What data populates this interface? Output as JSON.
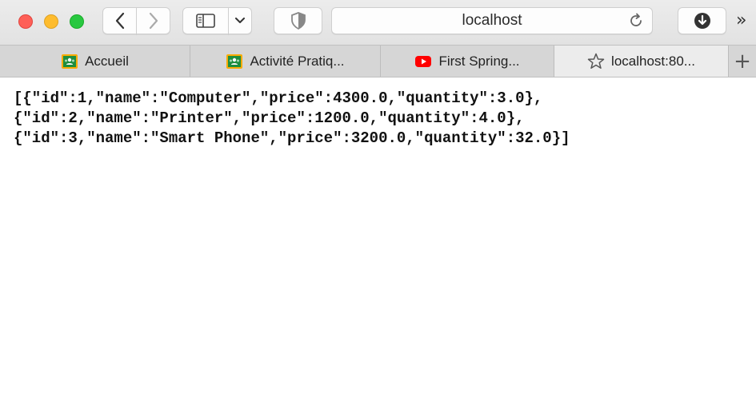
{
  "toolbar": {
    "url": "localhost"
  },
  "tabs": [
    {
      "label": "Accueil",
      "icon": "google-classroom-icon"
    },
    {
      "label": "Activité Pratiq...",
      "icon": "google-classroom-icon"
    },
    {
      "label": "First Spring...",
      "icon": "youtube-icon"
    },
    {
      "label": "localhost:80...",
      "icon": "star-icon",
      "active": true
    }
  ],
  "content": {
    "lines": [
      "[{\"id\":1,\"name\":\"Computer\",\"price\":4300.0,\"quantity\":3.0},",
      "{\"id\":2,\"name\":\"Printer\",\"price\":1200.0,\"quantity\":4.0},",
      "{\"id\":3,\"name\":\"Smart Phone\",\"price\":3200.0,\"quantity\":32.0}]"
    ]
  },
  "colors": {
    "close": "#fe5f57",
    "minimize": "#febc2e",
    "maximize": "#28c840",
    "classroom_green": "#1e8e3e",
    "youtube_red": "#ff0000"
  }
}
